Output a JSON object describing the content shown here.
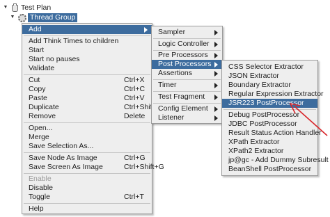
{
  "tree": {
    "root_label": "Test Plan",
    "group_label": "Thread Group"
  },
  "context_menu": {
    "items": [
      {
        "label": "Add"
      },
      {
        "label": "Add Think Times to children"
      },
      {
        "label": "Start"
      },
      {
        "label": "Start no pauses"
      },
      {
        "label": "Validate"
      },
      {
        "label": "Cut",
        "shortcut": "Ctrl+X"
      },
      {
        "label": "Copy",
        "shortcut": "Ctrl+C"
      },
      {
        "label": "Paste",
        "shortcut": "Ctrl+V"
      },
      {
        "label": "Duplicate",
        "shortcut": "Ctrl+Shift+C"
      },
      {
        "label": "Remove",
        "shortcut": "Delete"
      },
      {
        "label": "Open..."
      },
      {
        "label": "Merge"
      },
      {
        "label": "Save Selection As..."
      },
      {
        "label": "Save Node As Image",
        "shortcut": "Ctrl+G"
      },
      {
        "label": "Save Screen As Image",
        "shortcut": "Ctrl+Shift+G"
      },
      {
        "label": "Enable"
      },
      {
        "label": "Disable"
      },
      {
        "label": "Toggle",
        "shortcut": "Ctrl+T"
      },
      {
        "label": "Help"
      }
    ]
  },
  "add_menu": {
    "items": [
      {
        "label": "Sampler"
      },
      {
        "label": "Logic Controller"
      },
      {
        "label": "Pre Processors"
      },
      {
        "label": "Post Processors"
      },
      {
        "label": "Assertions"
      },
      {
        "label": "Timer"
      },
      {
        "label": "Test Fragment"
      },
      {
        "label": "Config Element"
      },
      {
        "label": "Listener"
      }
    ]
  },
  "post_processors_menu": {
    "items": [
      {
        "label": "CSS Selector Extractor"
      },
      {
        "label": "JSON Extractor"
      },
      {
        "label": "Boundary Extractor"
      },
      {
        "label": "Regular Expression Extractor"
      },
      {
        "label": "JSR223 PostProcessor"
      },
      {
        "label": "Debug PostProcessor"
      },
      {
        "label": "JDBC PostProcessor"
      },
      {
        "label": "Result Status Action Handler"
      },
      {
        "label": "XPath Extractor"
      },
      {
        "label": "XPath2 Extractor"
      },
      {
        "label": "jp@gc - Add Dummy Subresult"
      },
      {
        "label": "BeanShell PostProcessor"
      }
    ]
  },
  "colors": {
    "highlight": "#3d6c9e",
    "annotation_arrow": "#d9262b",
    "menu_background": "#eeeeee"
  }
}
